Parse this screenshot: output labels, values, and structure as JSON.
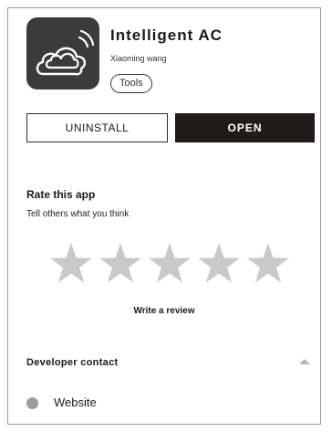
{
  "app": {
    "icon": "cloud-wifi-icon",
    "title": "Intelligent AC",
    "developer": "Xiaoming wang",
    "category": "Tools"
  },
  "actions": {
    "uninstall_label": "UNINSTALL",
    "open_label": "OPEN"
  },
  "rating": {
    "title": "Rate this app",
    "subtitle": "Tell others what you think",
    "star_icon": "star-icon",
    "stars_total": 5,
    "stars_selected": 0,
    "write_review_label": "Write a review"
  },
  "developer_contact": {
    "title": "Developer contact",
    "toggle_icon": "chevron-up-icon",
    "items": [
      {
        "icon": "circle-icon",
        "label": "Website"
      }
    ]
  },
  "colors": {
    "icon_bg": "#3b3b3b",
    "open_button_bg": "#201a18",
    "star_fill": "#c9c9c9",
    "website_dot": "#9c9c9c"
  }
}
